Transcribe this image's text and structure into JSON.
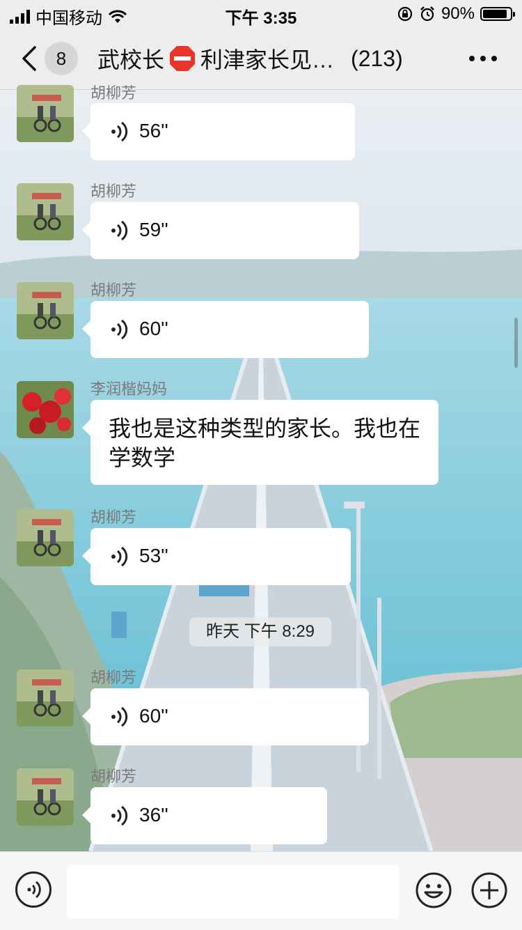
{
  "status_bar": {
    "carrier": "中国移动",
    "time": "下午 3:35",
    "battery": "90%",
    "icons": [
      "signal-icon",
      "wifi-icon",
      "rotation-lock-icon",
      "alarm-icon",
      "battery-icon"
    ]
  },
  "header": {
    "back_badge": "8",
    "title_part1": "武校长",
    "title_part2": "利津家长见…",
    "member_count": "(213)",
    "icons": [
      "back-icon",
      "stop-sign-icon",
      "more-icon"
    ]
  },
  "messages": [
    {
      "sender": "胡柳芳",
      "type": "voice",
      "duration": "56''"
    },
    {
      "sender": "胡柳芳",
      "type": "voice",
      "duration": "59''"
    },
    {
      "sender": "胡柳芳",
      "type": "voice",
      "duration": "60''"
    },
    {
      "sender": "李润楷妈妈",
      "type": "text",
      "text": "我也是这种类型的家长。我也在学数学"
    },
    {
      "sender": "胡柳芳",
      "type": "voice",
      "duration": "53''"
    },
    {
      "sender": "胡柳芳",
      "type": "voice",
      "duration": "60''"
    },
    {
      "sender": "胡柳芳",
      "type": "voice",
      "duration": "36''"
    }
  ],
  "timestamp": "昨天 下午 8:29",
  "input_bar": {
    "icons": [
      "voice-input-icon",
      "emoji-icon",
      "add-icon"
    ]
  },
  "colors": {
    "bar_background": "#ededed",
    "bubble": "#ffffff",
    "sender_name": "#7a7a7a",
    "sea": "#7ec9da",
    "stop_sign": "#e8342a"
  }
}
